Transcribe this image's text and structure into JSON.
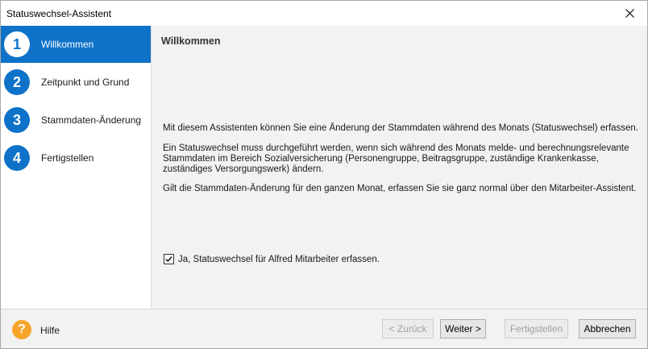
{
  "window": {
    "title": "Statuswechsel-Assistent"
  },
  "sidebar": {
    "steps": [
      {
        "number": "1",
        "label": "Willkommen",
        "active": true
      },
      {
        "number": "2",
        "label": "Zeitpunkt und Grund",
        "active": false
      },
      {
        "number": "3",
        "label": "Stammdaten-Änderung",
        "active": false
      },
      {
        "number": "4",
        "label": "Fertigstellen",
        "active": false
      }
    ]
  },
  "main": {
    "heading": "Willkommen",
    "paragraph1": "Mit diesem Assistenten können Sie eine Änderung der Stammdaten während des Monats (Statuswechsel) erfassen.",
    "paragraph2": "Ein Statuswechsel muss durchgeführt werden, wenn sich während des Monats melde- und berechnungsrelevante Stammdaten im Bereich Sozialversicherung (Personengruppe, Beitragsgruppe, zuständige Krankenkasse, zuständiges Versorgungswerk) ändern.",
    "paragraph3": "Gilt die Stammdaten-Änderung für den ganzen Monat, erfassen Sie sie ganz normal über den Mitarbeiter-Assistent.",
    "checkbox": {
      "label": "Ja, Statuswechsel für Alfred Mitarbeiter erfassen.",
      "checked": true
    }
  },
  "footer": {
    "help_label": "Hilfe",
    "help_icon_glyph": "?",
    "buttons": {
      "back": "< Zurück",
      "next": "Weiter >",
      "finish": "Fertigstellen",
      "cancel": "Abbrechen"
    }
  },
  "colors": {
    "accent": "#0e72c9",
    "help_orange": "#f7a52a",
    "panel_bg": "#f2f2f2"
  }
}
